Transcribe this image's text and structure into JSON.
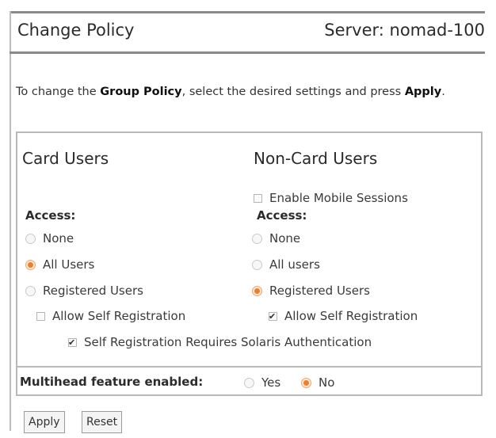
{
  "header": {
    "title": "Change Policy",
    "server": "Server: nomad-100"
  },
  "instructions": {
    "part1": "To change the ",
    "bold1": "Group Policy",
    "part2": ", select the desired settings and press ",
    "bold2": "Apply",
    "part3": "."
  },
  "card_users": {
    "heading": "Card Users",
    "access_label": "Access:",
    "options": [
      {
        "label": "None",
        "selected": false
      },
      {
        "label": "All Users",
        "selected": true
      },
      {
        "label": "Registered Users",
        "selected": false
      }
    ],
    "allow_self_registration": {
      "label": "Allow Self Registration",
      "checked": false
    }
  },
  "non_card_users": {
    "heading": "Non-Card Users",
    "enable_mobile_sessions": {
      "label": "Enable Mobile Sessions",
      "checked": false
    },
    "access_label": "Access:",
    "options": [
      {
        "label": "None",
        "selected": false
      },
      {
        "label": "All users",
        "selected": false
      },
      {
        "label": "Registered Users",
        "selected": true
      }
    ],
    "allow_self_registration": {
      "label": "Allow Self Registration",
      "checked": true
    }
  },
  "self_registration_solaris": {
    "label": "Self Registration Requires Solaris Authentication",
    "checked": true
  },
  "multihead": {
    "label": "Multihead feature enabled:",
    "options": [
      {
        "label": "Yes",
        "selected": false
      },
      {
        "label": "No",
        "selected": true
      }
    ]
  },
  "buttons": {
    "apply": "Apply",
    "reset": "Reset"
  },
  "colors": {
    "accent": "#ee7d2c",
    "border": "#b9b9b9",
    "rule": "#8a8a8a"
  }
}
